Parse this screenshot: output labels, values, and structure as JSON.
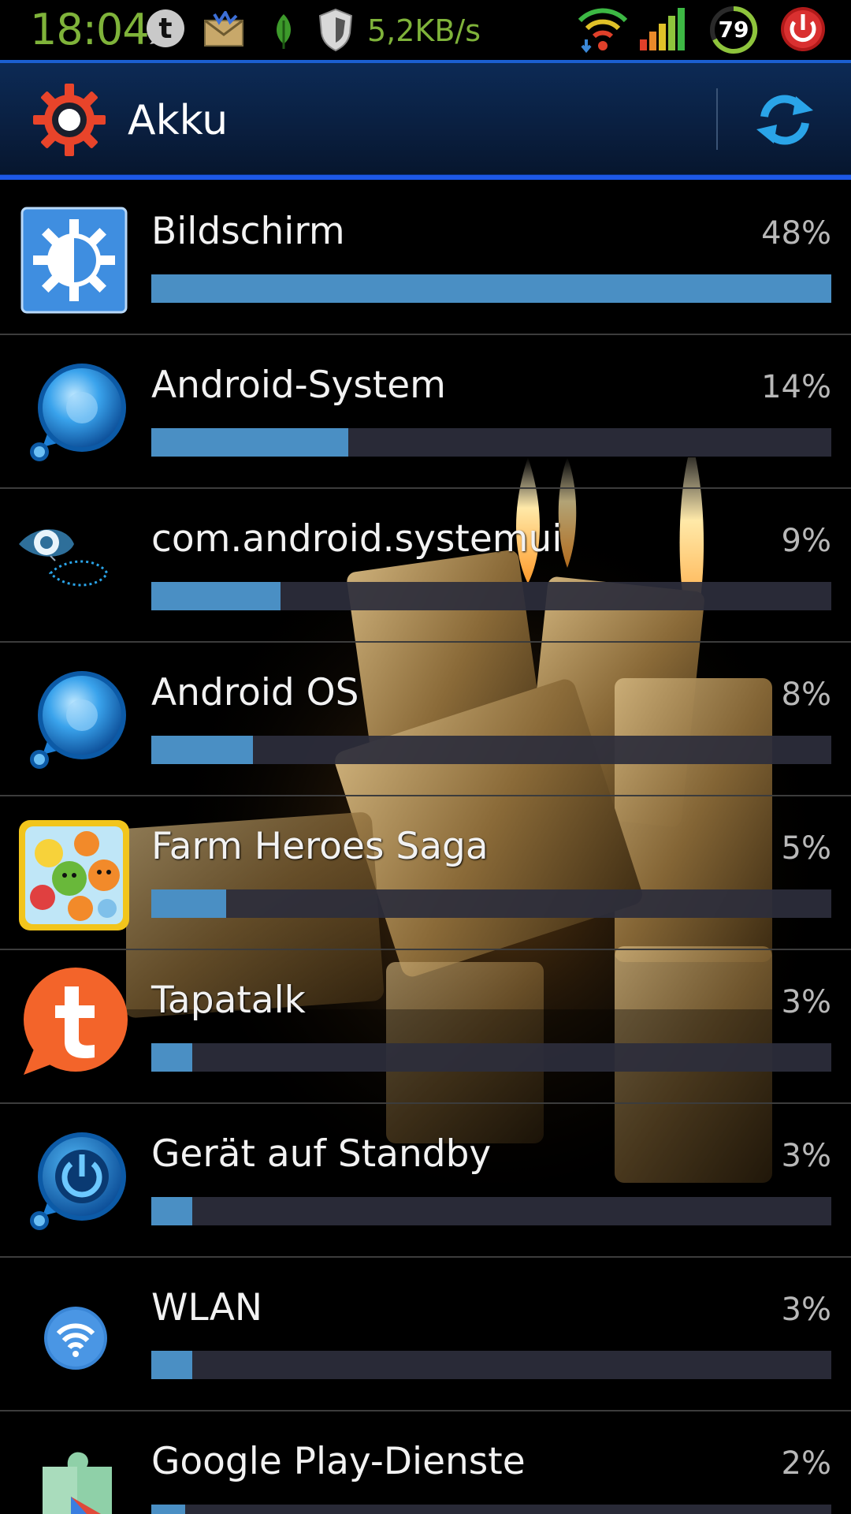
{
  "status_bar": {
    "time": "18:04",
    "network_speed": "5,2KB/s",
    "battery_level": "79",
    "icons": [
      "tapatalk-icon",
      "mail-icon",
      "leaf-icon",
      "shield-icon",
      "wifi-icon",
      "signal-icon",
      "battery-icon",
      "power-icon"
    ]
  },
  "action_bar": {
    "title": "Akku",
    "title_icon": "gear-icon",
    "refresh_icon": "refresh-icon"
  },
  "accent_color": "#4a8fc4",
  "items": [
    {
      "label": "Bildschirm",
      "percent": "48%",
      "fill": 1.0,
      "icon": "screen-brightness-icon"
    },
    {
      "label": "Android-System",
      "percent": "14%",
      "fill": 0.29,
      "icon": "android-system-icon"
    },
    {
      "label": "com.android.systemui",
      "percent": "9%",
      "fill": 0.19,
      "icon": "eye-icon"
    },
    {
      "label": "Android OS",
      "percent": "8%",
      "fill": 0.15,
      "icon": "android-os-icon"
    },
    {
      "label": "Farm Heroes Saga",
      "percent": "5%",
      "fill": 0.11,
      "icon": "farm-heroes-saga-icon"
    },
    {
      "label": "Tapatalk",
      "percent": "3%",
      "fill": 0.06,
      "icon": "tapatalk-icon"
    },
    {
      "label": "Gerät auf Standby",
      "percent": "3%",
      "fill": 0.06,
      "icon": "standby-power-icon"
    },
    {
      "label": "WLAN",
      "percent": "3%",
      "fill": 0.06,
      "icon": "wifi-icon"
    },
    {
      "label": "Google Play-Dienste",
      "percent": "2%",
      "fill": 0.05,
      "icon": "google-play-services-icon"
    }
  ]
}
